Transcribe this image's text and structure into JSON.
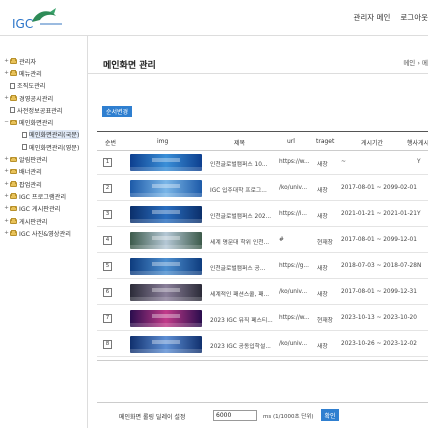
{
  "header": {
    "logo_text": "IGC",
    "links": [
      "관리자 메인",
      "로그아웃"
    ]
  },
  "sidebar": {
    "items": [
      {
        "label": "관리자",
        "type": "folder",
        "expand": "+"
      },
      {
        "label": "메뉴관리",
        "type": "folder",
        "expand": "+"
      },
      {
        "label": "조직도관리",
        "type": "doc",
        "expand": ""
      },
      {
        "label": "경영공시관리",
        "type": "folder",
        "expand": "+"
      },
      {
        "label": "사전정보공표관리",
        "type": "doc",
        "expand": ""
      },
      {
        "label": "메인화면관리",
        "type": "folder",
        "expand": "−"
      },
      {
        "label": "메인화면관리(국문)",
        "type": "doc",
        "expand": "",
        "child": true,
        "active": true
      },
      {
        "label": "메인화면관리(영문)",
        "type": "doc",
        "expand": "",
        "child": true
      },
      {
        "label": "알림판관리",
        "type": "folder",
        "expand": "+"
      },
      {
        "label": "배너관리",
        "type": "folder",
        "expand": "+"
      },
      {
        "label": "팝업관리",
        "type": "folder",
        "expand": "+"
      },
      {
        "label": "IGC 프로그램관리",
        "type": "folder",
        "expand": "+"
      },
      {
        "label": "IGC 게시판관리",
        "type": "folder",
        "expand": "+"
      },
      {
        "label": "게시판관리",
        "type": "folder",
        "expand": "+"
      },
      {
        "label": "IGC 사진&영상관리",
        "type": "folder",
        "expand": "+"
      }
    ]
  },
  "main": {
    "title": "메인화면 관리",
    "breadcrumb": "메인 › 메",
    "order_button": "순서변경",
    "columns": [
      "순번",
      "img",
      "제목",
      "url",
      "traget",
      "게시기간",
      "행사게시"
    ],
    "rows": [
      {
        "num": "1",
        "title": "인천글로벌캠퍼스 10...",
        "url": "https://w...",
        "target": "새창",
        "period": "~",
        "display": "Y",
        "colors": [
          "#0d3f8f",
          "#3a8fd8"
        ]
      },
      {
        "num": "2",
        "title": "IGC 입주대학 프로그...",
        "url": "/ko/univ...",
        "target": "새창",
        "period": "2017-08-01 ~ 2099-02-01",
        "display": "",
        "colors": [
          "#1d5aa8",
          "#7ab6e8"
        ]
      },
      {
        "num": "3",
        "title": "인천글로벌캠퍼스 202...",
        "url": "https://i...",
        "target": "새창",
        "period": "2021-01-21 ~ 2021-01-21",
        "display": "Y",
        "colors": [
          "#0b2f6b",
          "#2b6fc0"
        ]
      },
      {
        "num": "4",
        "title": "세계 명문대 학위 인천...",
        "url": "#",
        "target": "현재창",
        "period": "2017-08-01 ~ 2099-12-01",
        "display": "",
        "colors": [
          "#3c5a4a",
          "#b5c8d6"
        ]
      },
      {
        "num": "5",
        "title": "인천글로벌캠퍼스 공...",
        "url": "https://g...",
        "target": "새창",
        "period": "2018-07-03 ~ 2018-07-28",
        "display": "N",
        "colors": [
          "#0e3c7e",
          "#4d8fd0"
        ]
      },
      {
        "num": "6",
        "title": "세계적인 패션스쿨, 패...",
        "url": "/ko/univ...",
        "target": "새창",
        "period": "2017-08-01 ~ 2099-12-31",
        "display": "",
        "colors": [
          "#2b2b38",
          "#8a7f9a"
        ]
      },
      {
        "num": "7",
        "title": "2023 IGC 뮤직 페스티...",
        "url": "https://w...",
        "target": "현재창",
        "period": "2023-10-13 ~ 2023-10-20",
        "display": "",
        "colors": [
          "#2a0d4d",
          "#c23b8a"
        ]
      },
      {
        "num": "8",
        "title": "2023 IGC 공동입학설...",
        "url": "/ko/univ...",
        "target": "새창",
        "period": "2023-10-26 ~ 2023-12-02",
        "display": "",
        "colors": [
          "#10306e",
          "#5e8fd4"
        ]
      }
    ],
    "delay": {
      "label": "메인화면 롤링 딜레이 설정",
      "value": "6000",
      "unit": "ms (1/1000초 단위)",
      "confirm": "확인"
    }
  }
}
